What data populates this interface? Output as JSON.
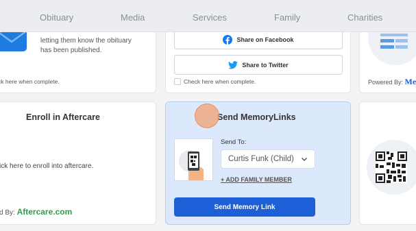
{
  "nav": {
    "items": [
      {
        "label": "Obituary"
      },
      {
        "label": "Media"
      },
      {
        "label": "Services"
      },
      {
        "label": "Family"
      },
      {
        "label": "Charities"
      }
    ]
  },
  "card_notify": {
    "description_line1": "letting them know the obituary",
    "description_line2": "has been published.",
    "check_label": "ck here when complete."
  },
  "card_share": {
    "facebook_label": "Share on Facebook",
    "twitter_label": "Share to Twitter",
    "check_label": "Check here when complete."
  },
  "card_poweredby": {
    "powered_label": "Powered By:",
    "brand": "Me"
  },
  "card_aftercare": {
    "title": "Enroll in Aftercare",
    "enroll_text": "ick here to enroll into aftercare.",
    "powered_label": "d By:",
    "brand": "Aftercare.com"
  },
  "card_memorylinks": {
    "title": "Send MemoryLinks",
    "send_to_label": "Send To:",
    "recipient": "Curtis Funk (Child)",
    "add_member_link": "+ ADD FAMILY MEMBER",
    "send_button": "Send Memory Link"
  },
  "colors": {
    "facebook": "#1877f2",
    "twitter": "#1d9bf0",
    "aftercare_green": "#2e9d4a",
    "primary_blue": "#1d5fd6",
    "highlight_card": "#dce8fb",
    "cursor": "#f0a070"
  }
}
